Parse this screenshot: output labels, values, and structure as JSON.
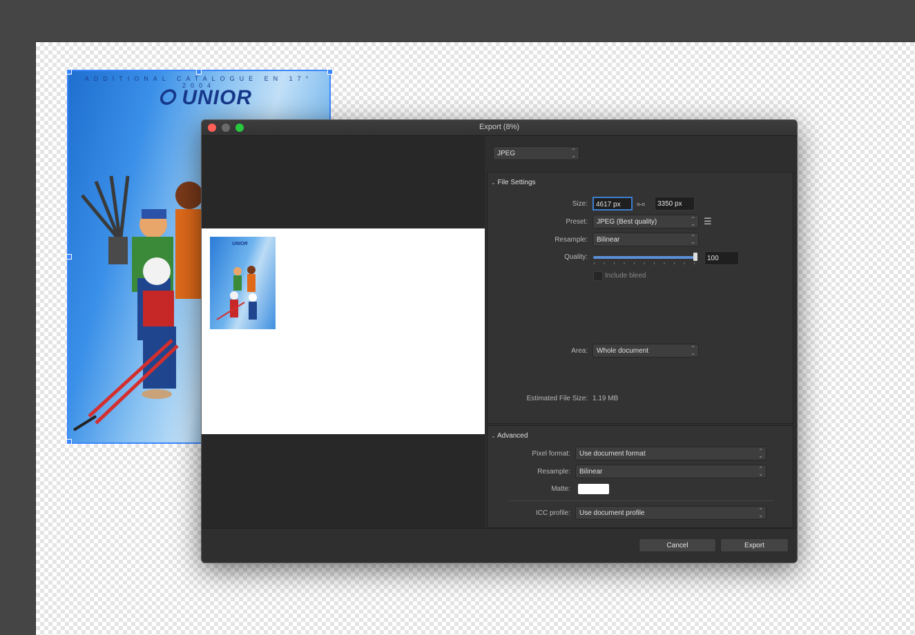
{
  "document": {
    "cover_tagline": "ADDITIONAL CATALOGUE EN 17° 2004",
    "cover_logo": "UNIOR"
  },
  "dialog": {
    "title": "Export (8%)",
    "format": "JPEG",
    "file_settings": {
      "header": "File Settings",
      "size_label": "Size:",
      "width": "4617 px",
      "height": "3350 px",
      "preset_label": "Preset:",
      "preset": "JPEG (Best quality)",
      "resample_label": "Resample:",
      "resample": "Bilinear",
      "quality_label": "Quality:",
      "quality": "100",
      "quality_fraction": 1.0,
      "include_bleed": "Include bleed",
      "area_label": "Area:",
      "area": "Whole document",
      "estimated_label": "Estimated File Size:",
      "estimated": "1.19 MB"
    },
    "advanced": {
      "header": "Advanced",
      "pixel_format_label": "Pixel format:",
      "pixel_format": "Use document format",
      "resample_label": "Resample:",
      "resample": "Bilinear",
      "matte_label": "Matte:",
      "icc_label": "ICC profile:",
      "icc": "Use document profile"
    },
    "cancel": "Cancel",
    "export": "Export"
  },
  "colors": {
    "close": "#ff5f57",
    "minimize": "#6a6a6a",
    "zoom": "#28c840",
    "selection": "#3a86ff"
  }
}
